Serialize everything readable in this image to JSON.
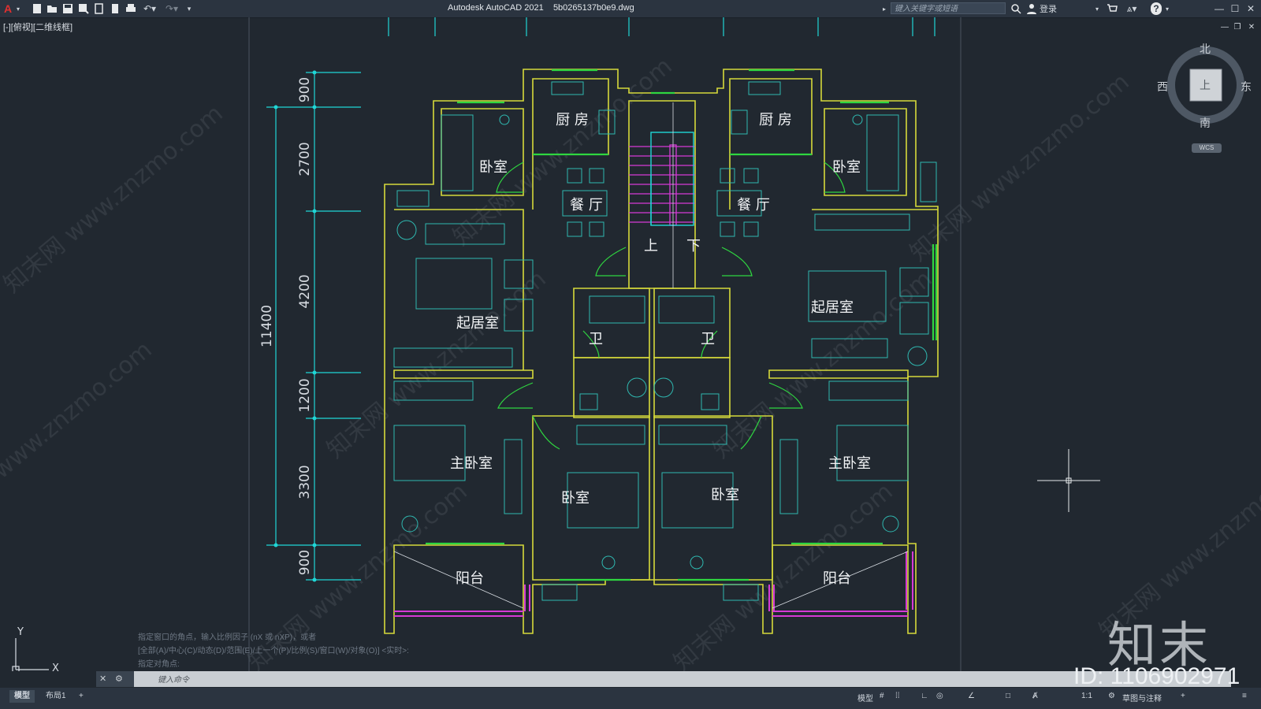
{
  "app": {
    "logo": "A",
    "title": "Autodesk AutoCAD 2021",
    "file": "5b0265137b0e9.dwg",
    "search_placeholder": "键入关键字或短语",
    "login": "登录",
    "help": "?",
    "viewport_label": "[-][俯视][二维线框]"
  },
  "quick_access": [
    "new-icon",
    "open-icon",
    "save-icon",
    "saveas-icon",
    "publish-icon",
    "plot-icon",
    "print-icon",
    "undo-icon",
    "redo-icon",
    "customize-icon"
  ],
  "colors": {
    "background": "#212830",
    "wall": "#d6d93a",
    "dimension": "#1fd6d6",
    "furniture": "#2fb8b0",
    "window": "#2fd640",
    "stair": "#d63ad6",
    "axis": "#00e0e0"
  },
  "drawing": {
    "dimensions": [
      "900",
      "2700",
      "4200",
      "1200",
      "3300",
      "900"
    ],
    "total_dimension": "11400",
    "rooms": [
      {
        "label": "厨 房"
      },
      {
        "label": "厨 房"
      },
      {
        "label": "卧室"
      },
      {
        "label": "卧室"
      },
      {
        "label": "餐 厅"
      },
      {
        "label": "餐 厅"
      },
      {
        "label": "上"
      },
      {
        "label": "下"
      },
      {
        "label": "起居室"
      },
      {
        "label": "起居室"
      },
      {
        "label": "卫"
      },
      {
        "label": "卫"
      },
      {
        "label": "主卧室"
      },
      {
        "label": "主卧室"
      },
      {
        "label": "卧室"
      },
      {
        "label": "卧室"
      },
      {
        "label": "阳台"
      },
      {
        "label": "阳台"
      }
    ]
  },
  "compass": {
    "north": "北",
    "south": "南",
    "east": "东",
    "west": "西",
    "top": "上",
    "wcs": "WCS"
  },
  "ucs": {
    "x": "X",
    "y": "Y"
  },
  "command": {
    "history": [
      "指定窗口的角点，输入比例因子 (nX 或 nXP)，或者",
      "[全部(A)/中心(C)/动态(D)/范围(E)/上一个(P)/比例(S)/窗口(W)/对象(O)] <实时>:",
      "指定对角点:"
    ],
    "placeholder": "键入命令"
  },
  "tabs": [
    "模型",
    "布局1",
    "+"
  ],
  "status": {
    "model": "模型",
    "scale": "1:1",
    "workspace": "草图与注释"
  },
  "watermark": {
    "logo": "知末",
    "id": "ID: 1106902971",
    "site": "知末网 www.znzmo.com"
  }
}
